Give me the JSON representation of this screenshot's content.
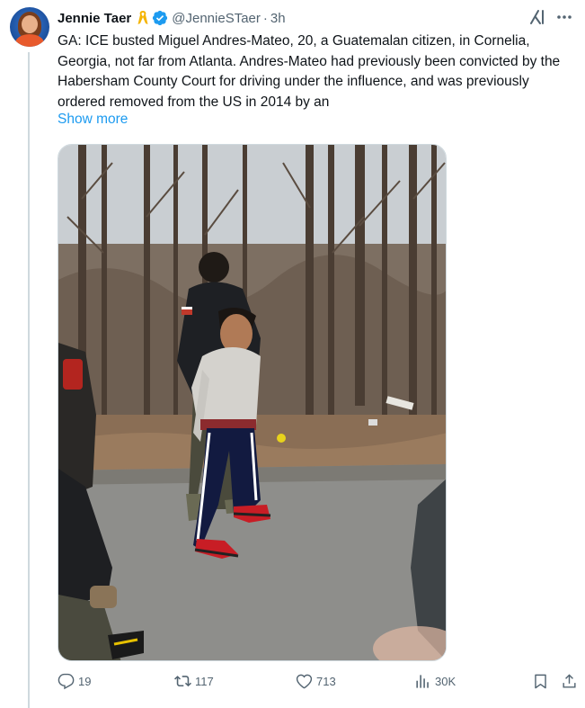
{
  "author": {
    "name": "Jennie Taer",
    "handle": "@JennieSTaer",
    "separator": "·",
    "time": "3h"
  },
  "tweet": {
    "text": "GA: ICE busted Miguel Andres-Mateo, 20, a Guatemalan citizen, in Cornelia, Georgia, not far from Atlanta. Andres-Mateo had previously been convicted by the Habersham County Court for driving under the influence, and was previously ordered removed from the US in 2014 by an",
    "show_more": "Show more"
  },
  "actions": {
    "replies": "19",
    "reposts": "117",
    "likes": "713",
    "views": "30K"
  },
  "colors": {
    "link": "#1d9bf0",
    "muted": "#536471",
    "verified": "#1d9bf0",
    "ribbon": "#f5b400"
  },
  "icons": {
    "ribbon": "awareness-ribbon-icon",
    "verified": "verified-badge-icon",
    "grok": "grok-icon",
    "more": "more-icon",
    "reply": "reply-icon",
    "repost": "repost-icon",
    "like": "heart-icon",
    "views": "views-icon",
    "bookmark": "bookmark-icon",
    "share": "share-icon"
  }
}
